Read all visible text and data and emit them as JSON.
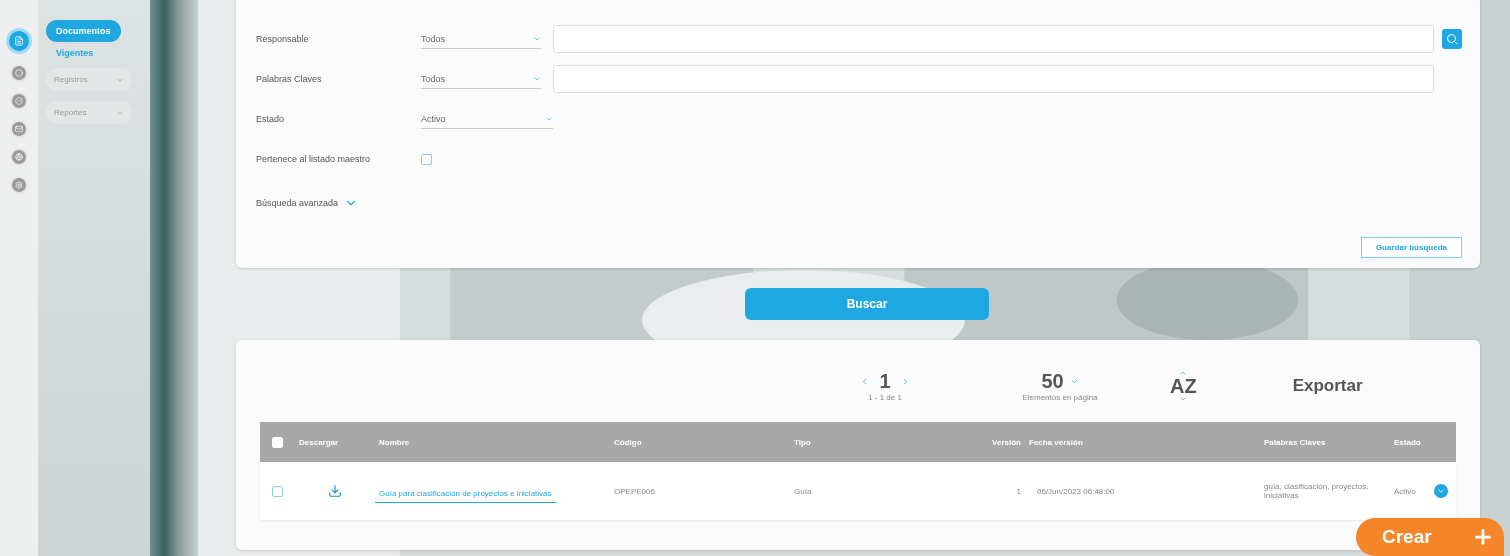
{
  "rail": {
    "items": [
      {
        "selected": true
      },
      {
        "selected": false
      },
      {
        "selected": false
      },
      {
        "selected": false
      },
      {
        "selected": false
      },
      {
        "selected": false
      }
    ]
  },
  "sidebar": {
    "menu_button": "Documentos",
    "items": [
      {
        "label": "Vigentes",
        "kind": "link"
      },
      {
        "label": "Registros",
        "kind": "dropdown"
      },
      {
        "label": "Reportes",
        "kind": "dropdown"
      }
    ]
  },
  "filters": [
    {
      "label": "Responsable",
      "kind": "select-text",
      "select": "Todos",
      "search_button": true
    },
    {
      "label": "Palabras Claves",
      "kind": "select-text",
      "select": "Todos"
    },
    {
      "label": "Estado",
      "kind": "select",
      "select": "Activo"
    },
    {
      "label": "Pertenece al listado maestro",
      "kind": "checkbox",
      "checked": false
    }
  ],
  "advanced_search": {
    "label": "Búsqueda avanzada",
    "expanded": false
  },
  "save_search_button": "Guardar búsqueda",
  "search_button": "Buscar",
  "results": {
    "page": "1",
    "page_range": "1 - 1 de 1",
    "page_size": "50",
    "page_size_label": "Elementos en página",
    "sort": "AZ",
    "export": "Exportar",
    "all_checked": false,
    "columns": [
      "Descargar",
      "Nombre",
      "Código",
      "Tipo",
      "Versión",
      "Fecha versión",
      "Palabras Claves",
      "Estado"
    ],
    "rows": [
      {
        "checked": false,
        "name": "Guía para clasificación de proyectos e iniciativas",
        "code": "OPEPE006",
        "type": "Guía",
        "version": "1",
        "date": "06/Jun/2023 06:48:00",
        "keywords": "guía, clasificación, proyectos, iniciativas",
        "status": "Activo"
      }
    ]
  },
  "create_button": "Crear"
}
